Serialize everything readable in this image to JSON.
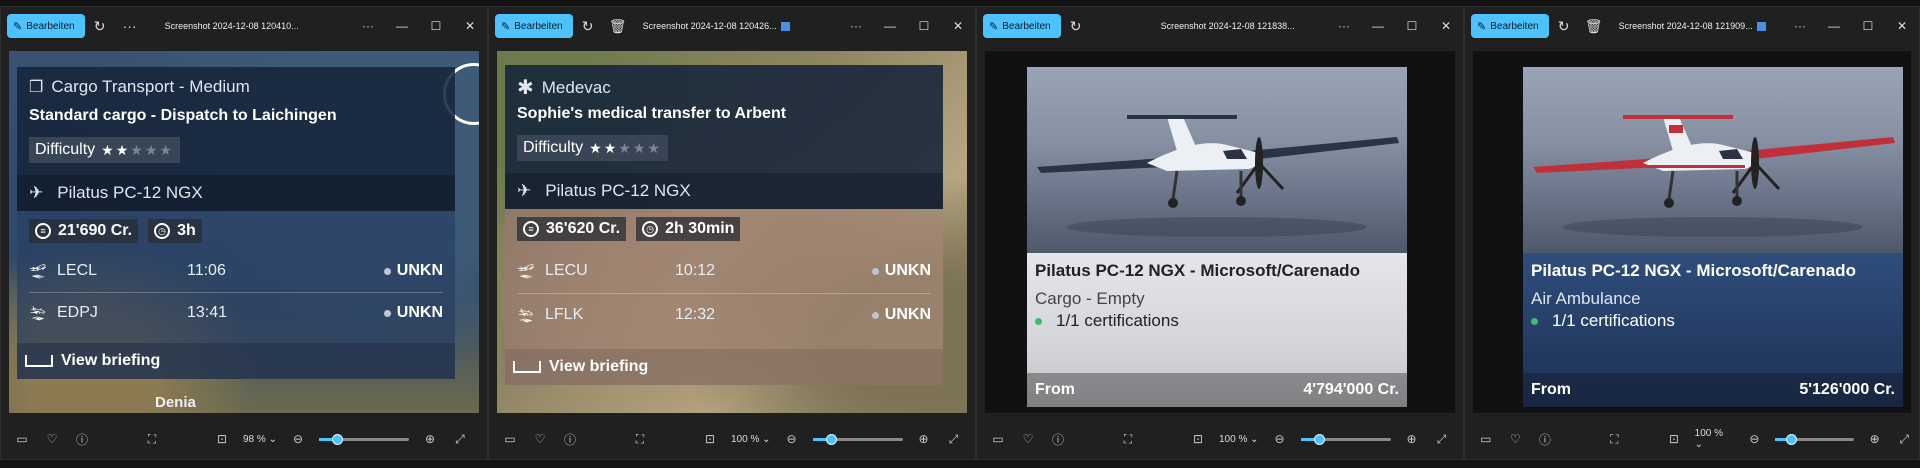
{
  "common": {
    "edit_label": "Bearbeiten",
    "more": "···",
    "minimize": "—",
    "maximize": "☐",
    "close": "✕"
  },
  "windows": [
    {
      "title": "Screenshot 2024-12-08 120410...",
      "zoom": "98 %",
      "zoom_fraction": 0.2,
      "panel": {
        "category": "Cargo Transport - Medium",
        "mission": "Standard cargo - Dispatch to Laichingen",
        "difficulty_label": "Difficulty",
        "stars_filled": 2,
        "stars_total": 5,
        "aircraft": "Pilatus PC-12 NGX",
        "reward": "21'690 Cr.",
        "duration": "3h",
        "legs": [
          {
            "airport": "LECL",
            "time": "11:06",
            "status": "UNKN"
          },
          {
            "airport": "EDPJ",
            "time": "13:41",
            "status": "UNKN"
          }
        ],
        "briefing": "View briefing",
        "map_label": "Denia"
      }
    },
    {
      "title": "Screenshot 2024-12-08 120426...",
      "zoom": "100 %",
      "zoom_fraction": 0.2,
      "panel": {
        "category": "Medevac",
        "mission": "Sophie's medical transfer to Arbent",
        "difficulty_label": "Difficulty",
        "stars_filled": 2,
        "stars_total": 5,
        "aircraft": "Pilatus PC-12 NGX",
        "reward": "36'620 Cr.",
        "duration": "2h 30min",
        "legs": [
          {
            "airport": "LECU",
            "time": "10:12",
            "status": "UNKN"
          },
          {
            "airport": "LFLK",
            "time": "12:32",
            "status": "UNKN"
          }
        ],
        "briefing": "View briefing"
      }
    },
    {
      "title": "Screenshot 2024-12-08 121838...",
      "zoom": "100 %",
      "zoom_fraction": 0.2,
      "card": {
        "name": "Pilatus PC-12 NGX - Microsoft/Carenado",
        "type": "Cargo - Empty",
        "certifications": "1/1 certifications",
        "from_label": "From",
        "price": "4'794'000 Cr.",
        "livery_accent": "#2a3444"
      }
    },
    {
      "title": "Screenshot 2024-12-08 121909...",
      "zoom": "100 %",
      "zoom_fraction": 0.2,
      "card": {
        "name": "Pilatus PC-12 NGX - Microsoft/Carenado",
        "type": "Air Ambulance",
        "certifications": "1/1 certifications",
        "from_label": "From",
        "price": "5'126'000 Cr.",
        "livery_accent": "#c0303a"
      }
    }
  ]
}
